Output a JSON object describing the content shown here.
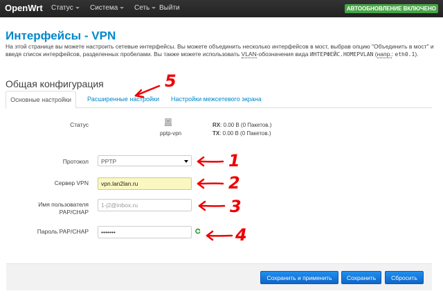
{
  "navbar": {
    "brand": "OpenWrt",
    "menu": [
      {
        "label": "Статус",
        "dropdown": true
      },
      {
        "label": "Система",
        "dropdown": true
      },
      {
        "label": "Сеть",
        "dropdown": true
      },
      {
        "label": "Выйти",
        "dropdown": false
      }
    ],
    "autoupdate_badge": "АВТООБНОВЛЕНИЕ ВКЛЮЧЕНО"
  },
  "page": {
    "title": "Интерфейсы - VPN",
    "description": {
      "part1": "На этой странице вы можете настроить сетевые интерфейсы. Вы можете объединить несколько интерфейсов в мост, выбрав опцию \"Объединить в мост\" и введя список интерфейсов, разделенных пробелами. Вы также можете использовать ",
      "vlan": "VLAN",
      "part2": "-обозначения вида ",
      "code1": "ИНТЕРФЕЙС.НОМЕРVLAN",
      "part3": " (",
      "example": "напр.",
      "part4": ": ",
      "code2": "eth0.1",
      "part5": ")."
    },
    "section_title": "Общая конфигурация",
    "tabs": [
      {
        "label": "Основные настройки",
        "active": true
      },
      {
        "label": "Расширенные настройки",
        "active": false
      },
      {
        "label": "Настройки межсетевого экрана",
        "active": false
      }
    ]
  },
  "form": {
    "status": {
      "label": "Статус",
      "device": "pptp-vpn",
      "rx_label": "RX",
      "rx_value": ": 0.00 B (0 Пакетов.)",
      "tx_label": "TX",
      "tx_value": ": 0.00 B (0 Пакетов.)"
    },
    "protocol": {
      "label": "Протокол",
      "value": "PPTP"
    },
    "server": {
      "label": "Сервер VPN",
      "value": "vpn.lan2lan.ru"
    },
    "username": {
      "label_line1": "Имя пользователя",
      "label_line2": "PAP/CHAP",
      "placeholder": "1-j2@inbox.ru"
    },
    "password": {
      "label": "Пароль PAP/CHAP",
      "value": "•••••••"
    }
  },
  "actions": {
    "save_apply": "Сохранить и применить",
    "save": "Сохранить",
    "reset": "Сбросить"
  },
  "annotations": {
    "n1": "1",
    "n2": "2",
    "n3": "3",
    "n4": "4",
    "n5": "5",
    "color": "#ee0000"
  },
  "colors": {
    "link": "#0088cc",
    "button": "#1a7ee0",
    "badge": "#46a546",
    "highlight_field": "#fbf7c1"
  }
}
